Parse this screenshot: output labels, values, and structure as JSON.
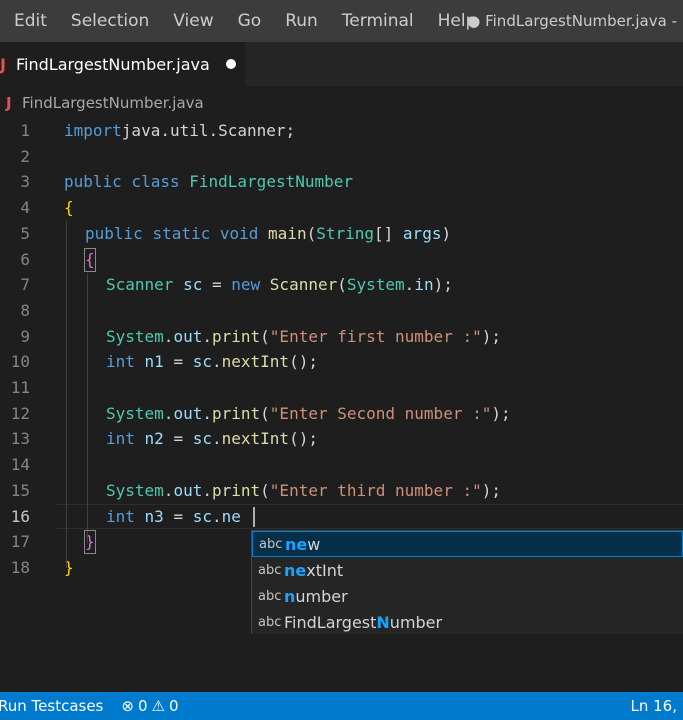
{
  "menubar": {
    "items": [
      "Edit",
      "Selection",
      "View",
      "Go",
      "Run",
      "Terminal",
      "Help"
    ],
    "window_title": "● FindLargestNumber.java -"
  },
  "tab": {
    "icon": "J",
    "label": "FindLargestNumber.java"
  },
  "breadcrumb": {
    "icon": "J",
    "label": "FindLargestNumber.java"
  },
  "editor": {
    "current_line": 16,
    "lines": [
      {
        "n": "1",
        "tokens": [
          [
            "kw",
            "import"
          ],
          [
            "",
            "java.util.Scanner;"
          ]
        ]
      },
      {
        "n": "2",
        "tokens": []
      },
      {
        "n": "3",
        "tokens": [
          [
            "kw",
            "public"
          ],
          [
            "",
            " "
          ],
          [
            "kw",
            "class"
          ],
          [
            "",
            " "
          ],
          [
            "ty",
            "FindLargestNumber"
          ]
        ]
      },
      {
        "n": "4",
        "tokens": [
          [
            "br",
            "{"
          ]
        ]
      },
      {
        "n": "5",
        "tokens": [
          [
            "",
            ""
          ],
          [
            "kw",
            "public"
          ],
          [
            "",
            " "
          ],
          [
            "kw",
            "static"
          ],
          [
            "",
            " "
          ],
          [
            "kw",
            "void"
          ],
          [
            "",
            " "
          ],
          [
            "fn",
            "main"
          ],
          [
            "",
            "("
          ],
          [
            "ty",
            "String"
          ],
          [
            "",
            "[] "
          ],
          [
            "vr",
            "args"
          ],
          [
            "",
            ")"
          ]
        ]
      },
      {
        "n": "6",
        "tokens": [
          [
            "brk",
            "{"
          ]
        ]
      },
      {
        "n": "7",
        "tokens": [
          [
            "ty",
            "Scanner"
          ],
          [
            "",
            " "
          ],
          [
            "vr",
            "sc"
          ],
          [
            "",
            " = "
          ],
          [
            "kw",
            "new"
          ],
          [
            "",
            " "
          ],
          [
            "fn",
            "Scanner"
          ],
          [
            "",
            "("
          ],
          [
            "ty",
            "System"
          ],
          [
            "",
            "."
          ],
          [
            "vr",
            "in"
          ],
          [
            "",
            ");"
          ]
        ]
      },
      {
        "n": "8",
        "tokens": []
      },
      {
        "n": "9",
        "tokens": [
          [
            "ty",
            "System"
          ],
          [
            "",
            "."
          ],
          [
            "vr",
            "out"
          ],
          [
            "",
            "."
          ],
          [
            "fn",
            "print"
          ],
          [
            "",
            "("
          ],
          [
            "st",
            "\"Enter first number :\""
          ],
          [
            "",
            ");"
          ]
        ]
      },
      {
        "n": "10",
        "tokens": [
          [
            "kw",
            "int"
          ],
          [
            "",
            " "
          ],
          [
            "vr",
            "n1"
          ],
          [
            "",
            " = "
          ],
          [
            "vr",
            "sc"
          ],
          [
            "",
            "."
          ],
          [
            "fn",
            "nextInt"
          ],
          [
            "",
            "();"
          ]
        ]
      },
      {
        "n": "11",
        "tokens": []
      },
      {
        "n": "12",
        "tokens": [
          [
            "ty",
            "System"
          ],
          [
            "",
            "."
          ],
          [
            "vr",
            "out"
          ],
          [
            "",
            "."
          ],
          [
            "fn",
            "print"
          ],
          [
            "",
            "("
          ],
          [
            "st",
            "\"Enter Second number :\""
          ],
          [
            "",
            ");"
          ]
        ]
      },
      {
        "n": "13",
        "tokens": [
          [
            "kw",
            "int"
          ],
          [
            "",
            " "
          ],
          [
            "vr",
            "n2"
          ],
          [
            "",
            " = "
          ],
          [
            "vr",
            "sc"
          ],
          [
            "",
            "."
          ],
          [
            "fn",
            "nextInt"
          ],
          [
            "",
            "();"
          ]
        ]
      },
      {
        "n": "14",
        "tokens": []
      },
      {
        "n": "15",
        "tokens": [
          [
            "ty",
            "System"
          ],
          [
            "",
            "."
          ],
          [
            "vr",
            "out"
          ],
          [
            "",
            "."
          ],
          [
            "fn",
            "print"
          ],
          [
            "",
            "("
          ],
          [
            "st",
            "\"Enter third number :\""
          ],
          [
            "",
            ");"
          ]
        ]
      },
      {
        "n": "16",
        "tokens": [
          [
            "kw",
            "int"
          ],
          [
            "",
            " "
          ],
          [
            "vr",
            "n3"
          ],
          [
            "",
            " = "
          ],
          [
            "vr",
            "sc"
          ],
          [
            "",
            "."
          ],
          [
            "vr",
            "ne"
          ]
        ]
      },
      {
        "n": "17",
        "tokens": [
          [
            "brk",
            "}"
          ]
        ]
      },
      {
        "n": "18",
        "tokens": [
          [
            "br",
            "}"
          ]
        ]
      }
    ]
  },
  "suggestions": {
    "kind_icon": "abc",
    "items": [
      {
        "label": "new",
        "match": "ne",
        "selected": true
      },
      {
        "label": "nextInt",
        "match": "ne",
        "selected": false
      },
      {
        "label": "number",
        "match": "n",
        "selected": false
      },
      {
        "label": "FindLargestNumber",
        "match": "N",
        "selected": false
      }
    ]
  },
  "statusbar": {
    "run_label": "Run Testcases",
    "errors_icon": "⊗",
    "errors": "0",
    "warnings_icon": "⚠",
    "warnings": "0",
    "position": "Ln 16,"
  }
}
